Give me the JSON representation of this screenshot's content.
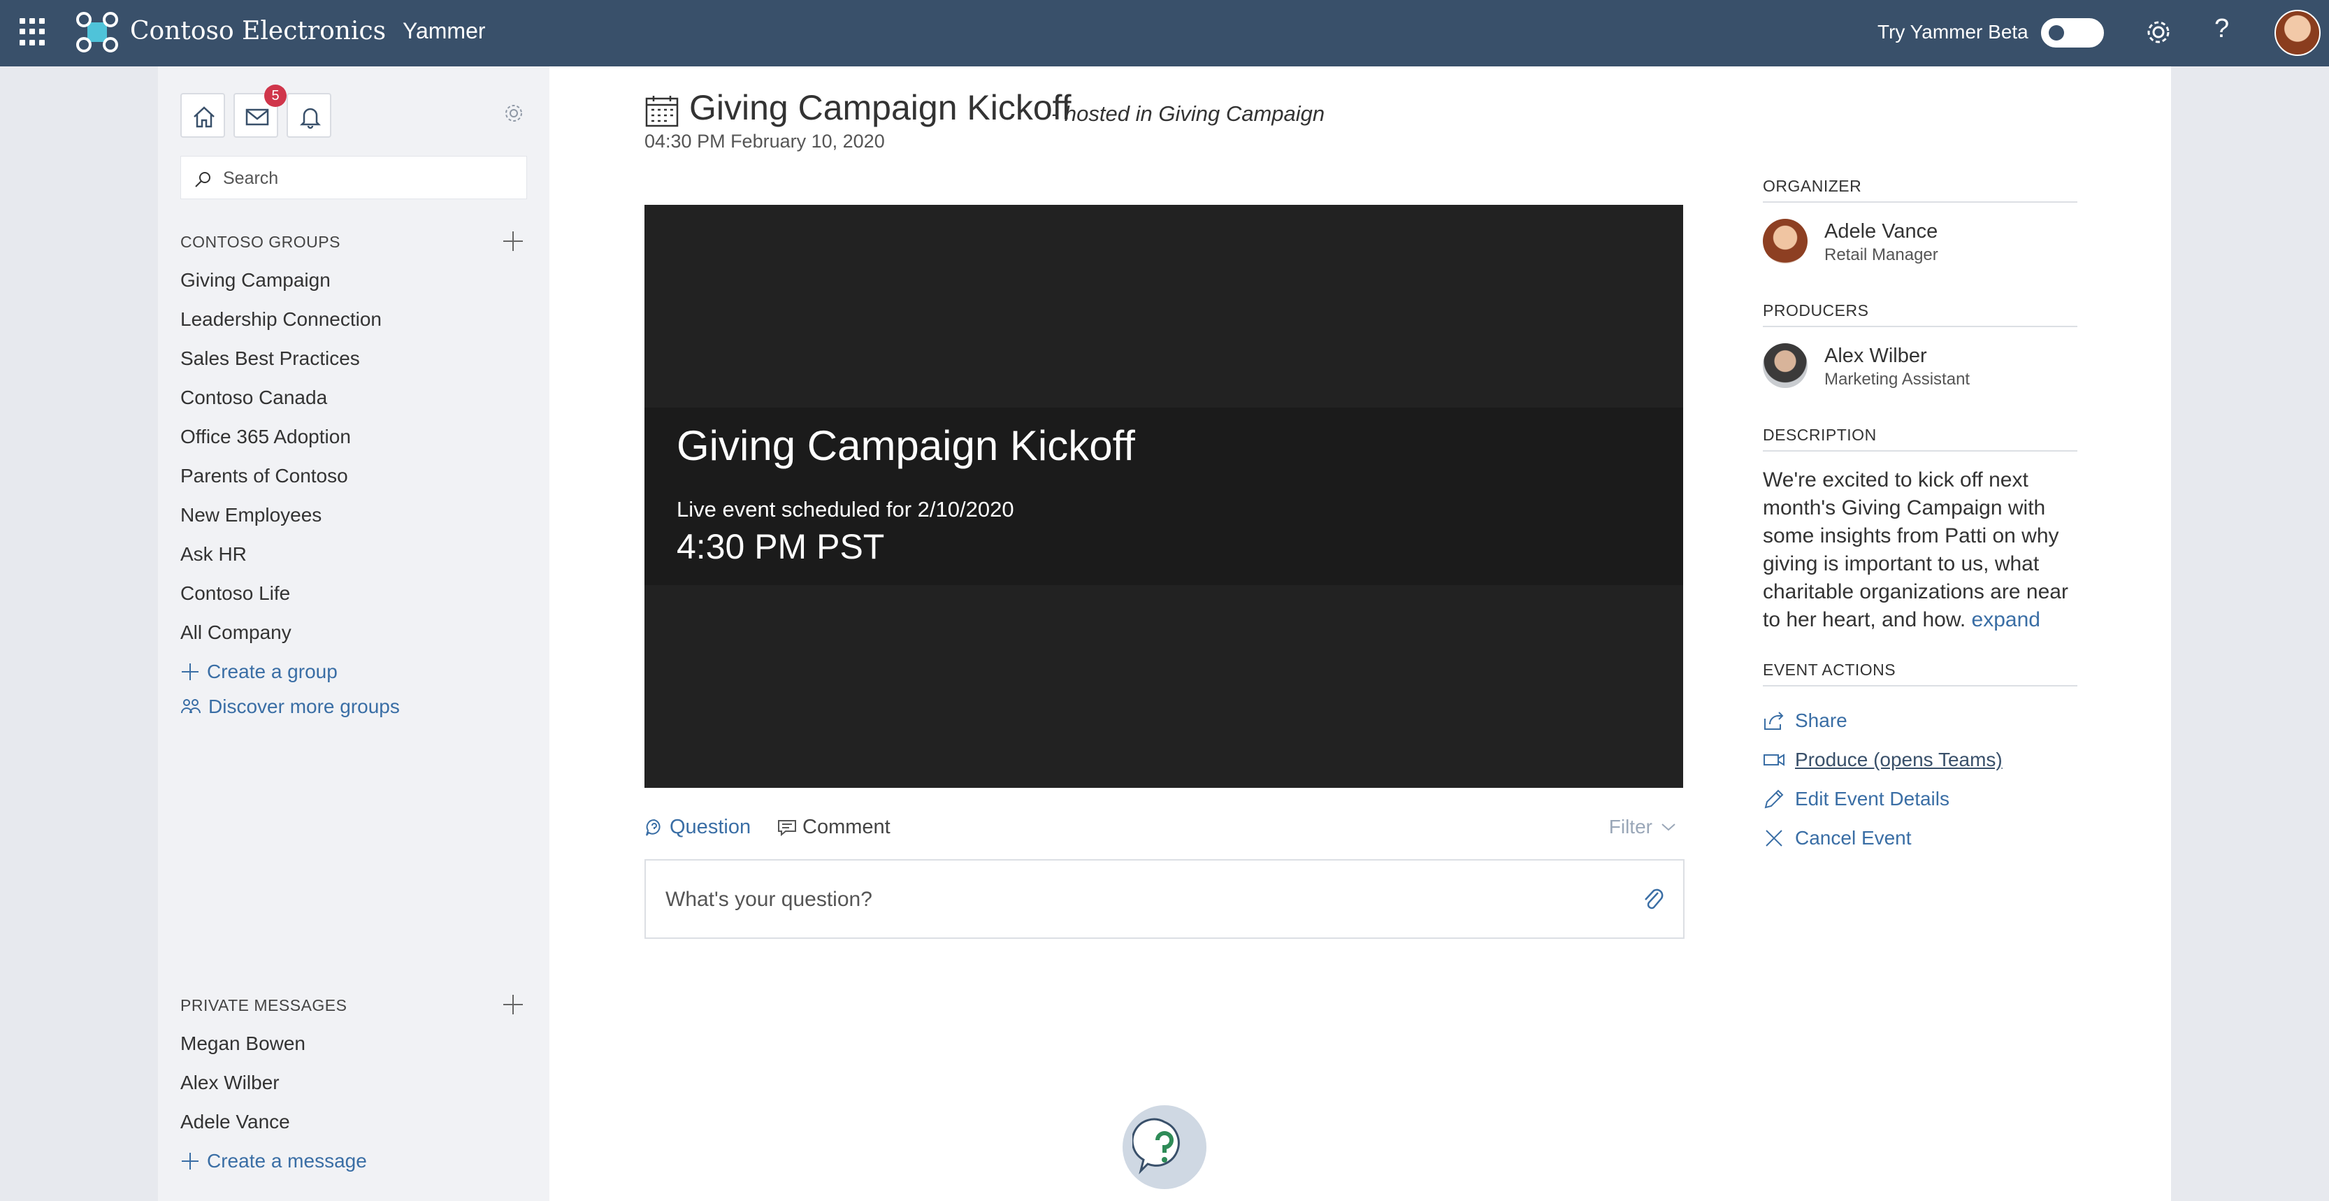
{
  "topbar": {
    "brand": "Contoso Electronics",
    "app": "Yammer",
    "beta_label": "Try Yammer Beta"
  },
  "nav": {
    "inbox_badge": "5",
    "search_placeholder": "Search",
    "groups_header": "CONTOSO GROUPS",
    "groups": [
      "Giving Campaign",
      "Leadership Connection",
      "Sales Best Practices",
      "Contoso Canada",
      "Office 365 Adoption",
      "Parents of Contoso",
      "New Employees",
      "Ask HR",
      "Contoso Life",
      "All Company"
    ],
    "create_group": "Create a group",
    "discover_groups": "Discover more groups",
    "pm_header": "PRIVATE MESSAGES",
    "private_messages": [
      "Megan Bowen",
      "Alex Wilber",
      "Adele Vance"
    ],
    "create_message": "Create a message"
  },
  "event": {
    "title": "Giving Campaign Kickoff",
    "hosted": "- hosted in Giving Campaign",
    "datetime": "04:30 PM February 10, 2020",
    "video_title": "Giving Campaign Kickoff",
    "video_scheduled": "Live event scheduled for 2/10/2020",
    "video_time": "4:30 PM PST"
  },
  "tabs": {
    "question": "Question",
    "comment": "Comment",
    "filter": "Filter"
  },
  "composer": {
    "placeholder": "What's your question?"
  },
  "rail": {
    "organizer_header": "ORGANIZER",
    "organizer": {
      "name": "Adele Vance",
      "role": "Retail Manager"
    },
    "producers_header": "PRODUCERS",
    "producer": {
      "name": "Alex Wilber",
      "role": "Marketing Assistant"
    },
    "description_header": "DESCRIPTION",
    "description": "We're excited to kick off next month's Giving Campaign with some insights from Patti on why giving is important to us, what charitable organizations are near to her heart, and how.",
    "expand": "expand",
    "actions_header": "EVENT ACTIONS",
    "actions": [
      "Share",
      "Produce (opens Teams)",
      "Edit Event Details",
      "Cancel Event"
    ]
  },
  "colors": {
    "topbar": "#39506a",
    "link": "#3a6ea5",
    "badge": "#d0364b",
    "video_bg": "#222222"
  }
}
